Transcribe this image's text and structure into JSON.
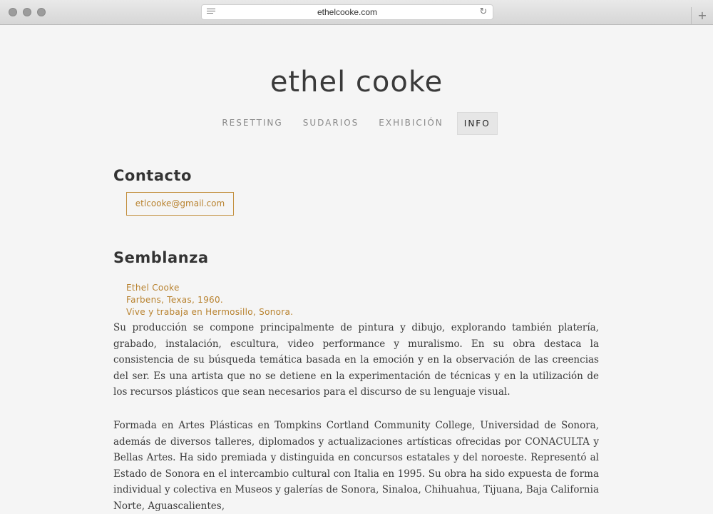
{
  "browser": {
    "url": "ethelcooke.com",
    "reader_icon": "reader-icon",
    "reload_icon": "↻",
    "newtab_icon": "+"
  },
  "site": {
    "title": "ethel cooke"
  },
  "nav": [
    {
      "label": "RESETTING",
      "active": false
    },
    {
      "label": "SUDARIOS",
      "active": false
    },
    {
      "label": "EXHIBICIÓN",
      "active": false
    },
    {
      "label": "INFO",
      "active": true
    }
  ],
  "contact": {
    "heading": "Contacto",
    "email": "etlcooke@gmail.com"
  },
  "bio": {
    "heading": "Semblanza",
    "name": "Ethel Cooke",
    "born": "Farbens, Texas, 1960.",
    "lives": "Vive y trabaja en Hermosillo, Sonora.",
    "paragraph1": "Su producción se compone principalmente de pintura y dibujo, explorando también platería, grabado, instalación, escultura, video performance y muralismo. En su obra destaca la consistencia de su búsqueda temática basada en la emoción y en la observación de las creencias del ser. Es una artista que no se detiene en la experimentación de técnicas y en la utilización de los recursos plásticos que sean necesarios para el discurso de su lenguaje visual.",
    "paragraph2": "Formada en Artes Plásticas en Tompkins Cortland Community College, Universidad de Sonora, además de diversos talleres, diplomados y actualizaciones artísticas ofrecidas por CONACULTA y Bellas Artes. Ha sido premiada y distinguida en concursos estatales y del noroeste. Representó al Estado de Sonora en el intercambio cultural con Italia en 1995. Su obra ha sido expuesta de forma individual y colectiva en Museos y galerías de Sonora, Sinaloa, Chihuahua, Tijuana, Baja California Norte, Aguascalientes,"
  },
  "colors": {
    "accent": "#b8822f",
    "text": "#3a3a3a",
    "background": "#f5f5f5"
  }
}
